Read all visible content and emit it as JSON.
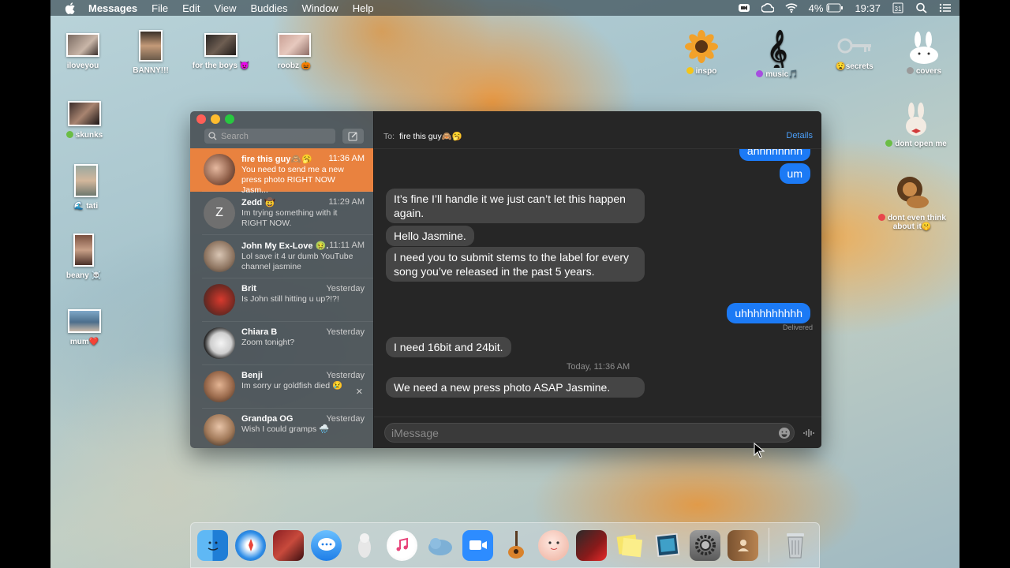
{
  "menubar": {
    "app_name": "Messages",
    "menus": [
      "File",
      "Edit",
      "View",
      "Buddies",
      "Window",
      "Help"
    ],
    "battery": "4%",
    "clock": "19:37"
  },
  "desktop": {
    "icons": [
      {
        "label": "iloveyou",
        "icon": "photo-thumb"
      },
      {
        "label": "BANNY!!!",
        "icon": "photo-thumb"
      },
      {
        "label": "for the boys 😈",
        "icon": "photo-thumb"
      },
      {
        "label": "roobz 🎃",
        "icon": "photo-thumb"
      },
      {
        "label": "skunks",
        "icon": "photo-thumb",
        "tag_color": "#6bbd45"
      },
      {
        "label": "🌊 tati",
        "icon": "photo-thumb"
      },
      {
        "label": "beany ☠️",
        "icon": "photo-thumb"
      },
      {
        "label": "mum❤️",
        "icon": "photo-thumb"
      },
      {
        "label": "inspo",
        "icon": "sunflower-icon",
        "tag_color": "#f5c518"
      },
      {
        "label": "music🎵",
        "icon": "treble-clef-icon",
        "tag_color": "#a64ee0"
      },
      {
        "label": "😧secrets",
        "icon": "key-icon"
      },
      {
        "label": "covers",
        "icon": "bunny-icon",
        "tag_color": "#9a9a9a"
      },
      {
        "label": "dont open me",
        "icon": "bunny-bow-icon",
        "tag_color": "#6bbd45"
      },
      {
        "label": "dont even think about it🤫",
        "icon": "lion-icon",
        "tag_color": "#e8464c"
      }
    ]
  },
  "sidebar": {
    "search_placeholder": "Search",
    "conversations": [
      {
        "name": "fire this guy🙈🥱",
        "time": "11:36 AM",
        "preview": "You need to send me a new press photo RIGHT NOW Jasm...",
        "selected": true
      },
      {
        "name": "Zedd 🤠",
        "time": "11:29 AM",
        "preview": "Im trying something with it RIGHT NOW.",
        "avatar_letter": "Z"
      },
      {
        "name": "John My Ex-Love 🤢...",
        "time": "11:11 AM",
        "preview": "Lol save it 4 ur dumb YouTube channel jasmine"
      },
      {
        "name": "Brit",
        "time": "Yesterday",
        "preview": "Is John still hitting u up?!?!"
      },
      {
        "name": "Chiara B",
        "time": "Yesterday",
        "preview": "Zoom tonight?"
      },
      {
        "name": "Benji",
        "time": "Yesterday",
        "preview": "Im sorry ur goldfish died 😢",
        "close": "✕"
      },
      {
        "name": "Grandpa OG",
        "time": "Yesterday",
        "preview": "Wish I could gramps 🌧️"
      }
    ]
  },
  "chat": {
    "to_label": "To:",
    "recipient": "fire this guy🙈🥱",
    "details_label": "Details",
    "messages": [
      {
        "dir": "out",
        "text": "ahhhhhhhh"
      },
      {
        "dir": "out",
        "text": "um"
      },
      {
        "dir": "in",
        "text": "It’s fine I’ll handle it we just can’t let this happen again."
      },
      {
        "dir": "in",
        "text": "Hello Jasmine."
      },
      {
        "dir": "in",
        "text": "I need you to submit stems to the label for every song you’ve released in the past 5 years."
      },
      {
        "dir": "out",
        "text": "uhhhhhhhhhh"
      },
      {
        "dir": "in",
        "text": "I need 16bit and 24bit."
      },
      {
        "dir": "in",
        "text": "We need a new press photo ASAP Jasmine."
      }
    ],
    "delivered_label": "Delivered",
    "timestamp": "Today, 11:36 AM",
    "input_placeholder": "iMessage"
  },
  "dock": {
    "apps": [
      "finder-icon",
      "safari-icon",
      "photo-booth-icon",
      "messages-icon",
      "goat-icon",
      "itunes-icon",
      "seal-icon",
      "zoom-icon",
      "garageband-icon",
      "face-icon",
      "photo-booth-red-icon",
      "stickies-icon",
      "preview-icon",
      "system-preferences-icon",
      "contacts-icon",
      "trash-icon"
    ]
  }
}
